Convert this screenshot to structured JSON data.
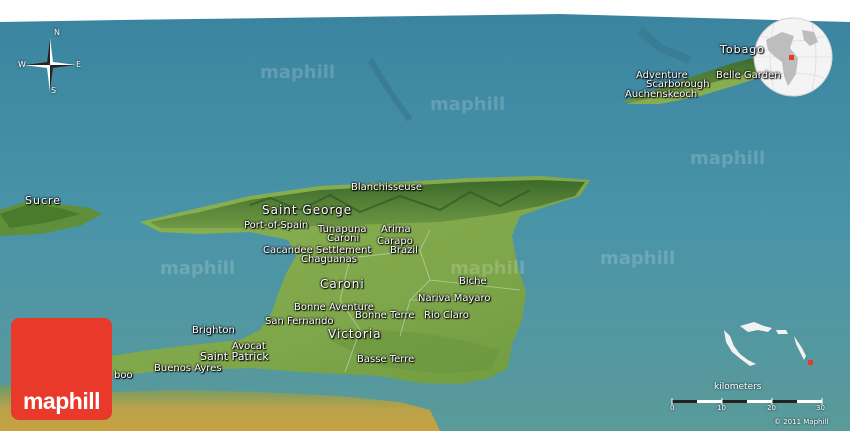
{
  "compass": {
    "n": "N",
    "s": "S",
    "e": "E",
    "w": "W"
  },
  "watermark": "maphill",
  "logo": {
    "text": "maphill",
    "color": "#e8392b"
  },
  "labels": {
    "tobago": "Tobago",
    "adventure": "Adventure",
    "belle_garden": "Belle Garden",
    "scarborough": "Scarborough",
    "auchenskeoch": "Auchenskeoch",
    "sucre": "Sucre",
    "blanchisseuse": "Blanchisseuse",
    "saint_george": "Saint George",
    "port_of_spain": "Port-of-Spain",
    "tunapuna": "Tunapuna",
    "arima": "Arima",
    "caroni_town": "Caroni",
    "carapo": "Carapo",
    "cacandee_settlement": "Cacandee Settlement",
    "chaguanas": "Chaguanas",
    "brazil": "Brazil",
    "caroni_region": "Caroni",
    "biche": "Biche",
    "nariva_mayaro": "Nariva Mayaro",
    "bonne_aventure": "Bonne Aventure",
    "san_fernando": "San Fernando",
    "bonne_terre": "Bonne Terre",
    "rio_claro": "Rio Claro",
    "victoria": "Victoria",
    "brighton": "Brighton",
    "avocat": "Avocat",
    "saint_patrick": "Saint Patrick",
    "buenos_ayres": "Buenos Ayres",
    "boo": "boo",
    "basse_terre": "Basse Terre"
  },
  "scale": {
    "title": "kilometers",
    "ticks": [
      "0",
      "10",
      "20",
      "30"
    ]
  },
  "copyright": "© 2011 Maphill",
  "colors": {
    "sea": "#3f8fa3",
    "land": "#7fa84a",
    "mountains": "#4f7a34",
    "accent": "#e8392b"
  }
}
